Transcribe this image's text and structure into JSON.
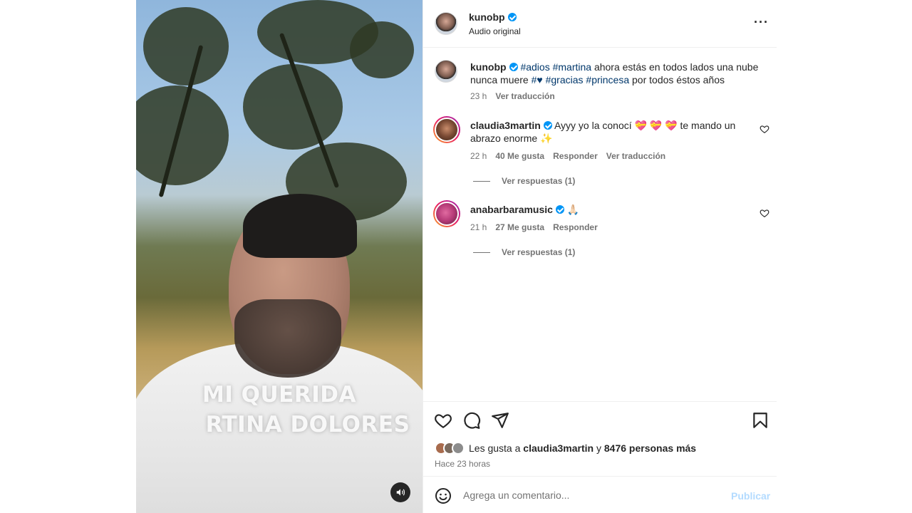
{
  "media": {
    "overlay_line_1": "MI QUERIDA",
    "overlay_line_2": "RTINA DOLORES",
    "audio_icon": "speaker-icon"
  },
  "header": {
    "username": "kunobp",
    "verified": true,
    "subtitle": "Audio original",
    "more_icon": "more-options-icon"
  },
  "caption": {
    "username": "kunobp",
    "tag_1": "#adios",
    "tag_2": "#martina",
    "text_1": "ahora estás en todos lados una nube nunca muere",
    "tag_3": "#♥",
    "tag_4": "#gracias",
    "tag_5": "#princesa",
    "text_2": "por todos éstos años",
    "time": "23 h",
    "translate": "Ver traducción"
  },
  "comments": [
    {
      "username": "claudia3martin",
      "text": "Ayyy yo la conocí 💝 💝 💝  te mando un abrazo enorme ✨",
      "time": "22 h",
      "likes": "40 Me gusta",
      "reply": "Responder",
      "translate": "Ver traducción",
      "view_replies": "Ver respuestas (1)"
    },
    {
      "username": "anabarbaramusic",
      "text": "🙏🏻",
      "time": "21 h",
      "likes": "27 Me gusta",
      "reply": "Responder",
      "view_replies": "Ver respuestas (1)"
    }
  ],
  "actions": {
    "like_icon": "heart-icon",
    "comment_icon": "comment-icon",
    "share_icon": "share-icon",
    "save_icon": "bookmark-icon",
    "likes_prefix": "Les gusta a",
    "likes_user": "claudia3martin",
    "likes_joiner": "y",
    "likes_rest": "8476 personas más",
    "time_ago": "Hace 23 horas"
  },
  "add_comment": {
    "placeholder": "Agrega un comentario...",
    "publish": "Publicar",
    "emoji_icon": "emoji-icon"
  },
  "colors": {
    "verified": "#0095f6",
    "hashtag": "#00376b",
    "secondary_text": "#737373",
    "publish_disabled": "#b3dbff"
  }
}
